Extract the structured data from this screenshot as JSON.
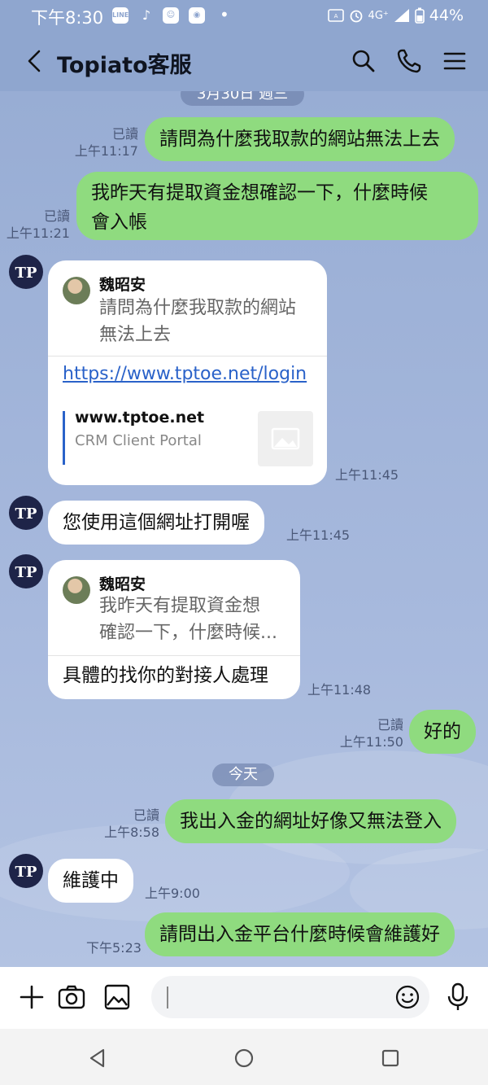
{
  "status_bar": {
    "time": "下午8:30",
    "icons_left": [
      "LINE",
      "♪",
      "☺",
      "◉"
    ],
    "network": "4G⁺",
    "battery": "44%"
  },
  "header": {
    "title": "Topiato客服",
    "back_icon": "back-arrow-icon",
    "actions": [
      "search-icon",
      "phone-icon",
      "menu-icon"
    ]
  },
  "chat": {
    "date_1": "3月30日 週三",
    "date_2": "今天",
    "read_label": "已讀",
    "messages": [
      {
        "side": "out",
        "text": "請問為什麼我取款的網站無法上去",
        "time": "上午11:17",
        "read": true
      },
      {
        "side": "out",
        "lines": [
          "我昨天有提取資金想確認一下，什麼時候",
          "會入帳"
        ],
        "time": "上午11:21",
        "read": true
      },
      {
        "side": "in",
        "type": "reply-card",
        "quote_name": "魏昭安",
        "quote_lines": [
          "請問為什麼我取款的網站",
          "無法上去"
        ],
        "link": "https://www.tptoe.net/login",
        "preview_domain": "www.tptoe.net",
        "preview_title": "CRM Client Portal",
        "time": "上午11:45"
      },
      {
        "side": "in",
        "text": "您使用這個網址打開喔",
        "time": "上午11:45"
      },
      {
        "side": "in",
        "type": "reply",
        "quote_name": "魏昭安",
        "quote_lines": [
          "我昨天有提取資金想",
          "確認一下，什麼時候..."
        ],
        "text": "具體的找你的對接人處理",
        "time": "上午11:48"
      },
      {
        "side": "out",
        "text": "好的",
        "time": "上午11:50",
        "read": true
      },
      {
        "side": "out",
        "text": "我出入金的網址好像又無法登入",
        "time": "上午8:58",
        "read": true
      },
      {
        "side": "in",
        "text": "維護中",
        "time": "上午9:00"
      },
      {
        "side": "out",
        "text": "請問出入金平台什麼時候會維護好",
        "time": "下午5:23",
        "read": false
      }
    ]
  },
  "composer": {
    "placeholder": "",
    "icons": [
      "plus-icon",
      "camera-icon",
      "image-icon",
      "emoji-icon",
      "microphone-icon"
    ]
  },
  "colors": {
    "chat_bg": "#98add4",
    "bubble_out": "#8fdb7f",
    "bubble_in": "#ffffff",
    "link": "#2a62c9",
    "avatar_bg": "#1e2448"
  }
}
